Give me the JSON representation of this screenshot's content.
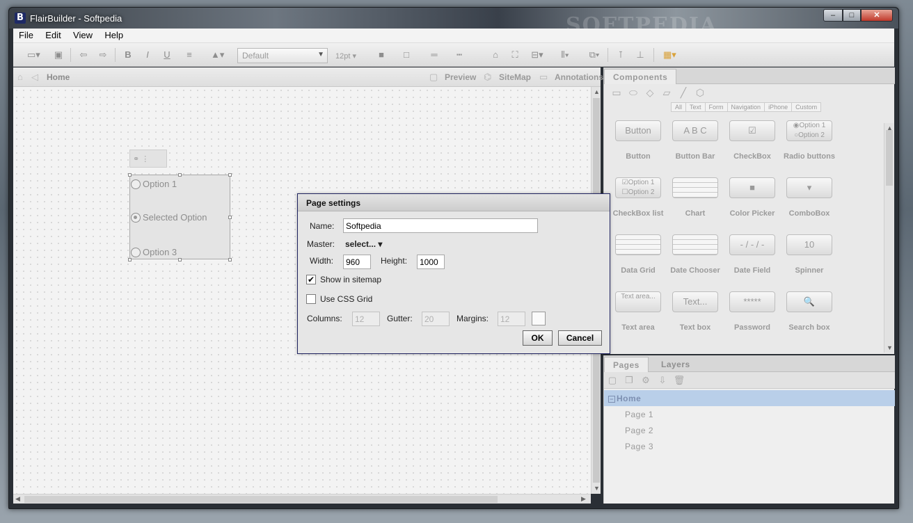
{
  "window": {
    "title": "FlairBuilder  - Softpedia",
    "app_icon": "B",
    "minimize_glyph": "–",
    "maximize_glyph": "□",
    "close_glyph": "✕"
  },
  "menu": [
    "File",
    "Edit",
    "View",
    "Help"
  ],
  "toolbar": {
    "font_family": "Default",
    "font_size": "12pt ▾"
  },
  "canvas_header": {
    "breadcrumb": "Home",
    "preview_label": "Preview",
    "sitemap_label": "SiteMap",
    "annotations_label": "Annotations"
  },
  "canvas_widget": {
    "options": [
      "Option 1",
      "Selected Option",
      "Option 3"
    ],
    "selected_index": 1,
    "toolbox_glyphs": "⚭ ⋮"
  },
  "components_panel": {
    "tab": "Components",
    "filters": [
      "All",
      "Text",
      "Form",
      "Navigation",
      "iPhone",
      "Custom"
    ],
    "items": [
      {
        "label": "Button",
        "thumb": "Button"
      },
      {
        "label": "Button Bar",
        "thumb": "A B C"
      },
      {
        "label": "CheckBox",
        "thumb": "☑"
      },
      {
        "label": "Radio buttons",
        "thumb": "◉Option 1 ○Option 2"
      },
      {
        "label": "CheckBox list",
        "thumb": "☑Option 1 ☐Option 2"
      },
      {
        "label": "Chart",
        "thumb": ""
      },
      {
        "label": "Color Picker",
        "thumb": "■"
      },
      {
        "label": "ComboBox",
        "thumb": "▾"
      },
      {
        "label": "Data Grid",
        "thumb": ""
      },
      {
        "label": "Date Chooser",
        "thumb": ""
      },
      {
        "label": "Date Field",
        "thumb": "- / - / -"
      },
      {
        "label": "Spinner",
        "thumb": "10"
      },
      {
        "label": "Text area",
        "thumb": "Text area..."
      },
      {
        "label": "Text box",
        "thumb": "Text..."
      },
      {
        "label": "Password",
        "thumb": "*****"
      },
      {
        "label": "Search box",
        "thumb": "🔍"
      }
    ]
  },
  "pages_panel": {
    "tabs": [
      "Pages",
      "Layers"
    ],
    "tree_root": "Home",
    "pages": [
      "Page 1",
      "Page 2",
      "Page 3"
    ]
  },
  "dialog": {
    "title": "Page settings",
    "name_label": "Name:",
    "name_value": "Softpedia",
    "master_label": "Master:",
    "master_value": "select... ▾",
    "width_label": "Width:",
    "width_value": "960",
    "height_label": "Height:",
    "height_value": "1000",
    "show_in_sitemap_label": "Show in sitemap",
    "show_in_sitemap_checked": true,
    "use_css_grid_label": "Use CSS Grid",
    "use_css_grid_checked": false,
    "columns_label": "Columns:",
    "columns_value": "12",
    "gutter_label": "Gutter:",
    "gutter_value": "20",
    "margins_label": "Margins:",
    "margins_value": "12",
    "ok_label": "OK",
    "cancel_label": "Cancel"
  },
  "watermark": "SOFTPEDIA"
}
